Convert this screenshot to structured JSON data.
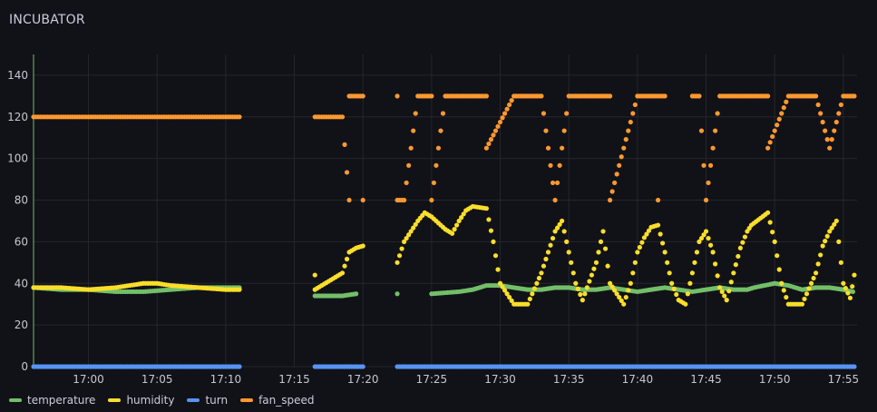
{
  "panel": {
    "title": "INCUBATOR"
  },
  "chart_data": {
    "type": "scatter",
    "ylim": [
      0,
      150
    ],
    "yticks": [
      0,
      20,
      40,
      60,
      80,
      100,
      120,
      140
    ],
    "xlim": [
      "16:56",
      "17:56"
    ],
    "xticks": [
      "17:00",
      "17:05",
      "17:10",
      "17:15",
      "17:20",
      "17:25",
      "17:30",
      "17:35",
      "17:40",
      "17:45",
      "17:50",
      "17:55"
    ],
    "grid": true,
    "legend_position": "bottom-left",
    "series": [
      {
        "name": "temperature",
        "color": "#73bf69",
        "points": [
          [
            "16:56",
            38
          ],
          [
            "16:58",
            37
          ],
          [
            "17:00",
            37
          ],
          [
            "17:02",
            36
          ],
          [
            "17:04",
            36
          ],
          [
            "17:06",
            37
          ],
          [
            "17:08",
            38
          ],
          [
            "17:10",
            38
          ],
          [
            "17:11",
            38
          ],
          [
            "17:16.5",
            34
          ],
          [
            "17:18.5",
            34
          ],
          [
            "17:19.5",
            35
          ],
          [
            "17:22.5",
            35
          ],
          [
            "17:25",
            35
          ],
          [
            "17:27",
            36
          ],
          [
            "17:28",
            37
          ],
          [
            "17:29",
            39
          ],
          [
            "17:30",
            39
          ],
          [
            "17:31",
            38
          ],
          [
            "17:32",
            37
          ],
          [
            "17:33",
            37
          ],
          [
            "17:34",
            38
          ],
          [
            "17:35",
            38
          ],
          [
            "17:36",
            37
          ],
          [
            "17:37",
            37
          ],
          [
            "17:38",
            38
          ],
          [
            "17:39",
            37
          ],
          [
            "17:40",
            36
          ],
          [
            "17:41",
            37
          ],
          [
            "17:42",
            38
          ],
          [
            "17:43",
            37
          ],
          [
            "17:44",
            36
          ],
          [
            "17:45",
            37
          ],
          [
            "17:46",
            38
          ],
          [
            "17:47",
            37
          ],
          [
            "17:48",
            37
          ],
          [
            "17:48.5",
            38
          ],
          [
            "17:50",
            40
          ],
          [
            "17:51",
            39
          ],
          [
            "17:52",
            37
          ],
          [
            "17:53",
            38
          ],
          [
            "17:54",
            38
          ],
          [
            "17:55",
            37
          ],
          [
            "17:55.7",
            36
          ]
        ]
      },
      {
        "name": "humidity",
        "color": "#fade2a",
        "points": [
          [
            "16:56",
            38
          ],
          [
            "16:58",
            38
          ],
          [
            "17:00",
            37
          ],
          [
            "17:02",
            38
          ],
          [
            "17:03",
            39
          ],
          [
            "17:04",
            40
          ],
          [
            "17:05",
            40
          ],
          [
            "17:06",
            39
          ],
          [
            "17:08",
            38
          ],
          [
            "17:10",
            37
          ],
          [
            "17:11",
            37
          ],
          [
            "17:16.5",
            44
          ],
          [
            "17:16.5",
            37
          ],
          [
            "17:18.5",
            45
          ],
          [
            "17:19",
            55
          ],
          [
            "17:19.5",
            57
          ],
          [
            "17:20",
            58
          ],
          [
            "17:22.5",
            50
          ],
          [
            "17:23",
            60
          ],
          [
            "17:23.5",
            65
          ],
          [
            "17:24",
            70
          ],
          [
            "17:24.5",
            74
          ],
          [
            "17:25",
            72
          ],
          [
            "17:26",
            66
          ],
          [
            "17:26.5",
            64
          ],
          [
            "17:27",
            70
          ],
          [
            "17:27.5",
            75
          ],
          [
            "17:28",
            77
          ],
          [
            "17:29",
            76
          ],
          [
            "17:29.5",
            60
          ],
          [
            "17:30",
            40
          ],
          [
            "17:31",
            30
          ],
          [
            "17:32",
            30
          ],
          [
            "17:33",
            45
          ],
          [
            "17:33.5",
            55
          ],
          [
            "17:34",
            65
          ],
          [
            "17:34.5",
            70
          ],
          [
            "17:35",
            55
          ],
          [
            "17:35.5",
            40
          ],
          [
            "17:36",
            32
          ],
          [
            "17:37",
            50
          ],
          [
            "17:37.5",
            65
          ],
          [
            "17:38",
            40
          ],
          [
            "17:38.5",
            35
          ],
          [
            "17:39",
            30
          ],
          [
            "17:39.5",
            40
          ],
          [
            "17:40",
            55
          ],
          [
            "17:40.5",
            62
          ],
          [
            "17:41",
            67
          ],
          [
            "17:41.5",
            68
          ],
          [
            "17:42",
            55
          ],
          [
            "17:42.5",
            40
          ],
          [
            "17:43",
            32
          ],
          [
            "17:43.5",
            30
          ],
          [
            "17:44.5",
            60
          ],
          [
            "17:45",
            65
          ],
          [
            "17:45.5",
            55
          ],
          [
            "17:46",
            38
          ],
          [
            "17:46.5",
            32
          ],
          [
            "17:47",
            45
          ],
          [
            "17:47.5",
            57
          ],
          [
            "17:48",
            65
          ],
          [
            "17:48.3",
            68
          ],
          [
            "17:49.5",
            74
          ],
          [
            "17:50",
            60
          ],
          [
            "17:50.5",
            40
          ],
          [
            "17:51",
            30
          ],
          [
            "17:52",
            30
          ],
          [
            "17:53",
            45
          ],
          [
            "17:53.5",
            58
          ],
          [
            "17:54",
            65
          ],
          [
            "17:54.5",
            70
          ],
          [
            "17:55",
            40
          ],
          [
            "17:55.5",
            33
          ],
          [
            "17:55.8",
            44
          ]
        ]
      },
      {
        "name": "turn",
        "color": "#5794f2",
        "points": [
          [
            "16:56",
            0
          ],
          [
            "16:58",
            0
          ],
          [
            "17:00",
            0
          ],
          [
            "17:02",
            0
          ],
          [
            "17:04",
            0
          ],
          [
            "17:06",
            0
          ],
          [
            "17:08",
            0
          ],
          [
            "17:10",
            0
          ],
          [
            "17:11",
            0
          ],
          [
            "17:16.5",
            0
          ],
          [
            "17:18.5",
            0
          ],
          [
            "17:19.5",
            0
          ],
          [
            "17:20",
            0
          ],
          [
            "17:22.5",
            0
          ],
          [
            "17:24",
            0
          ],
          [
            "17:26",
            0
          ],
          [
            "17:28",
            0
          ],
          [
            "17:29",
            0
          ],
          [
            "17:31",
            0
          ],
          [
            "17:33",
            0
          ],
          [
            "17:35",
            0
          ],
          [
            "17:37",
            0
          ],
          [
            "17:38",
            0
          ],
          [
            "17:40",
            0
          ],
          [
            "17:42",
            0
          ],
          [
            "17:44",
            0
          ],
          [
            "17:44.5",
            0
          ],
          [
            "17:46",
            0
          ],
          [
            "17:48",
            0
          ],
          [
            "17:49.5",
            0
          ],
          [
            "17:51",
            0
          ],
          [
            "17:53",
            0
          ],
          [
            "17:55",
            0
          ],
          [
            "17:55.8",
            0
          ]
        ]
      },
      {
        "name": "fan_speed",
        "color": "#ff9830",
        "points": [
          [
            "16:56",
            120
          ],
          [
            "16:58",
            120
          ],
          [
            "17:00",
            120
          ],
          [
            "17:02",
            120
          ],
          [
            "17:04",
            120
          ],
          [
            "17:06",
            120
          ],
          [
            "17:08",
            120
          ],
          [
            "17:10",
            120
          ],
          [
            "17:11",
            120
          ],
          [
            "17:16.5",
            120
          ],
          [
            "17:18.5",
            120
          ],
          [
            "17:19",
            80
          ],
          [
            "17:19",
            130
          ],
          [
            "17:20",
            130
          ],
          [
            "17:20",
            80
          ],
          [
            "17:22.5",
            130
          ],
          [
            "17:22.5",
            80
          ],
          [
            "17:23",
            80
          ],
          [
            "17:24",
            130
          ],
          [
            "17:25",
            130
          ],
          [
            "17:25",
            80
          ],
          [
            "17:26",
            130
          ],
          [
            "17:28",
            130
          ],
          [
            "17:29",
            130
          ],
          [
            "17:29",
            105
          ],
          [
            "17:31",
            130
          ],
          [
            "17:33",
            130
          ],
          [
            "17:34",
            80
          ],
          [
            "17:35",
            130
          ],
          [
            "17:37",
            130
          ],
          [
            "17:38",
            130
          ],
          [
            "17:38",
            80
          ],
          [
            "17:40",
            130
          ],
          [
            "17:42",
            130
          ],
          [
            "17:41.5",
            80
          ],
          [
            "17:44",
            130
          ],
          [
            "17:44.5",
            130
          ],
          [
            "17:45",
            80
          ],
          [
            "17:46",
            130
          ],
          [
            "17:48",
            130
          ],
          [
            "17:49.5",
            130
          ],
          [
            "17:49.5",
            105
          ],
          [
            "17:51",
            130
          ],
          [
            "17:53",
            130
          ],
          [
            "17:54",
            105
          ],
          [
            "17:55",
            130
          ],
          [
            "17:55.8",
            130
          ]
        ]
      }
    ]
  }
}
